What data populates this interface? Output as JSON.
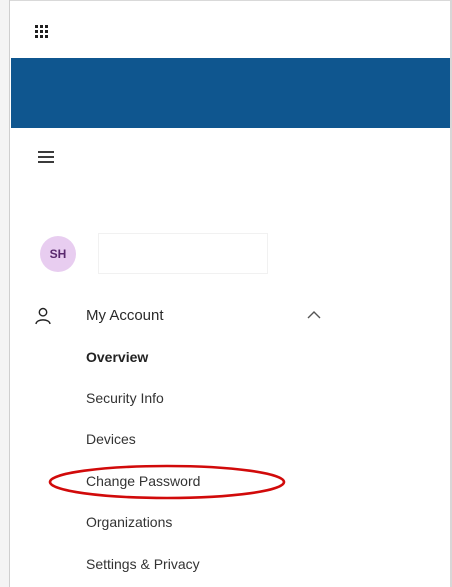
{
  "colors": {
    "header_blue": "#0f568f",
    "avatar_bg": "#e8cdf0",
    "avatar_text": "#5a2a6e",
    "highlight_red": "#d10a0a"
  },
  "icons": {
    "launcher": "waffle-icon",
    "menu": "hamburger-icon",
    "account": "person-icon",
    "collapse": "chevron-up-icon"
  },
  "user": {
    "initials": "SH"
  },
  "nav": {
    "section_label": "My Account",
    "items": [
      {
        "label": "Overview",
        "active": true
      },
      {
        "label": "Security Info",
        "active": false
      },
      {
        "label": "Devices",
        "active": false
      },
      {
        "label": "Change Password",
        "active": false,
        "highlighted": true
      },
      {
        "label": "Organizations",
        "active": false
      },
      {
        "label": "Settings & Privacy",
        "active": false
      }
    ]
  }
}
